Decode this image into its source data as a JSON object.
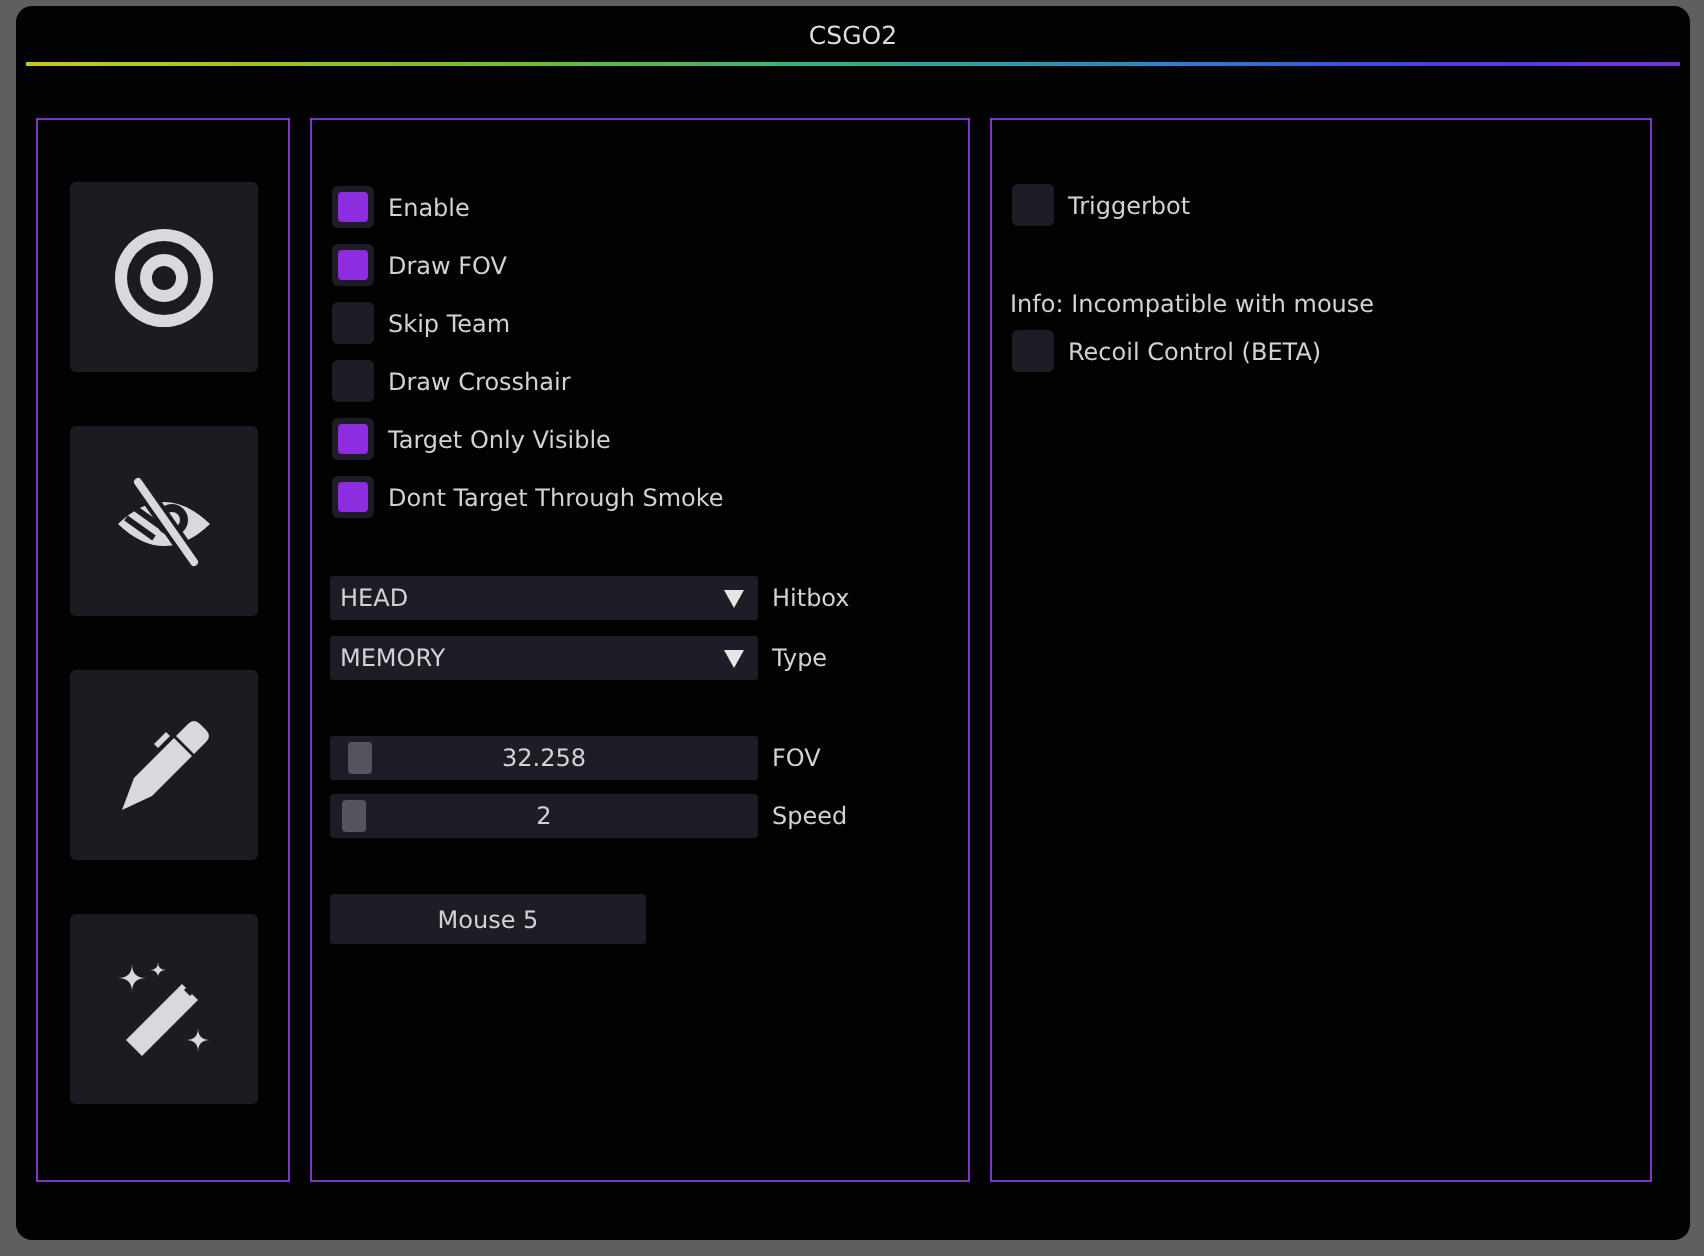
{
  "window": {
    "title": "CSGO2"
  },
  "sidebar": {
    "items": [
      {
        "kind": "target"
      },
      {
        "kind": "eye-slash"
      },
      {
        "kind": "pen"
      },
      {
        "kind": "wand"
      }
    ]
  },
  "aim_panel": {
    "checkboxes": [
      {
        "label": "Enable",
        "checked": true
      },
      {
        "label": "Draw FOV",
        "checked": true
      },
      {
        "label": "Skip Team",
        "checked": false
      },
      {
        "label": "Draw Crosshair",
        "checked": false
      },
      {
        "label": "Target Only Visible",
        "checked": true
      },
      {
        "label": "Dont Target Through Smoke",
        "checked": true
      }
    ],
    "dropdowns": [
      {
        "value": "HEAD",
        "label": "Hitbox"
      },
      {
        "value": "MEMORY",
        "label": "Type"
      }
    ],
    "sliders": [
      {
        "value": "32.258",
        "label": "FOV",
        "level": 0.035
      },
      {
        "value": "2",
        "label": "Speed",
        "level": 0.02
      }
    ],
    "key_button": {
      "label": "Mouse 5"
    }
  },
  "trigger_panel": {
    "items": [
      {
        "kind": "checkbox",
        "label": "Triggerbot",
        "checked": false
      },
      {
        "kind": "info",
        "text": "Info: Incompatible with mouse"
      },
      {
        "kind": "checkbox",
        "label": "Recoil Control (BETA)",
        "checked": false
      }
    ]
  }
}
